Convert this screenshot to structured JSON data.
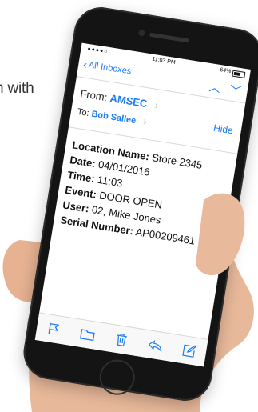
{
  "background": {
    "partial_text": "n with"
  },
  "status_bar": {
    "carrier": "●●●●○",
    "time": "11:03 PM",
    "battery": "64%"
  },
  "nav": {
    "back_label": "All Inboxes",
    "back_icon": "chevron-left-icon",
    "up_icon": "chevron-up-icon",
    "down_icon": "chevron-down-icon"
  },
  "header": {
    "from_label": "From:",
    "from_name": "AMSEC",
    "to_label": "To:",
    "to_name": "Bob Sallee",
    "hide_label": "Hide"
  },
  "message": {
    "location_label": "Location Name:",
    "location_value": "Store 2345",
    "date_label": "Date:",
    "date_value": "04/01/2016",
    "time_label": "Time:",
    "time_value": "11:03",
    "event_label": "Event:",
    "event_value": "DOOR OPEN",
    "user_label": "User:",
    "user_value": "02, Mike Jones",
    "serial_label": "Serial Number:",
    "serial_value": "AP00209461"
  },
  "toolbar": [
    "flag-icon",
    "folder-icon",
    "trash-icon",
    "reply-icon",
    "compose-icon"
  ],
  "colors": {
    "accent": "#1b7cf2",
    "phone": "#141414",
    "skin": "#e8b89a"
  }
}
